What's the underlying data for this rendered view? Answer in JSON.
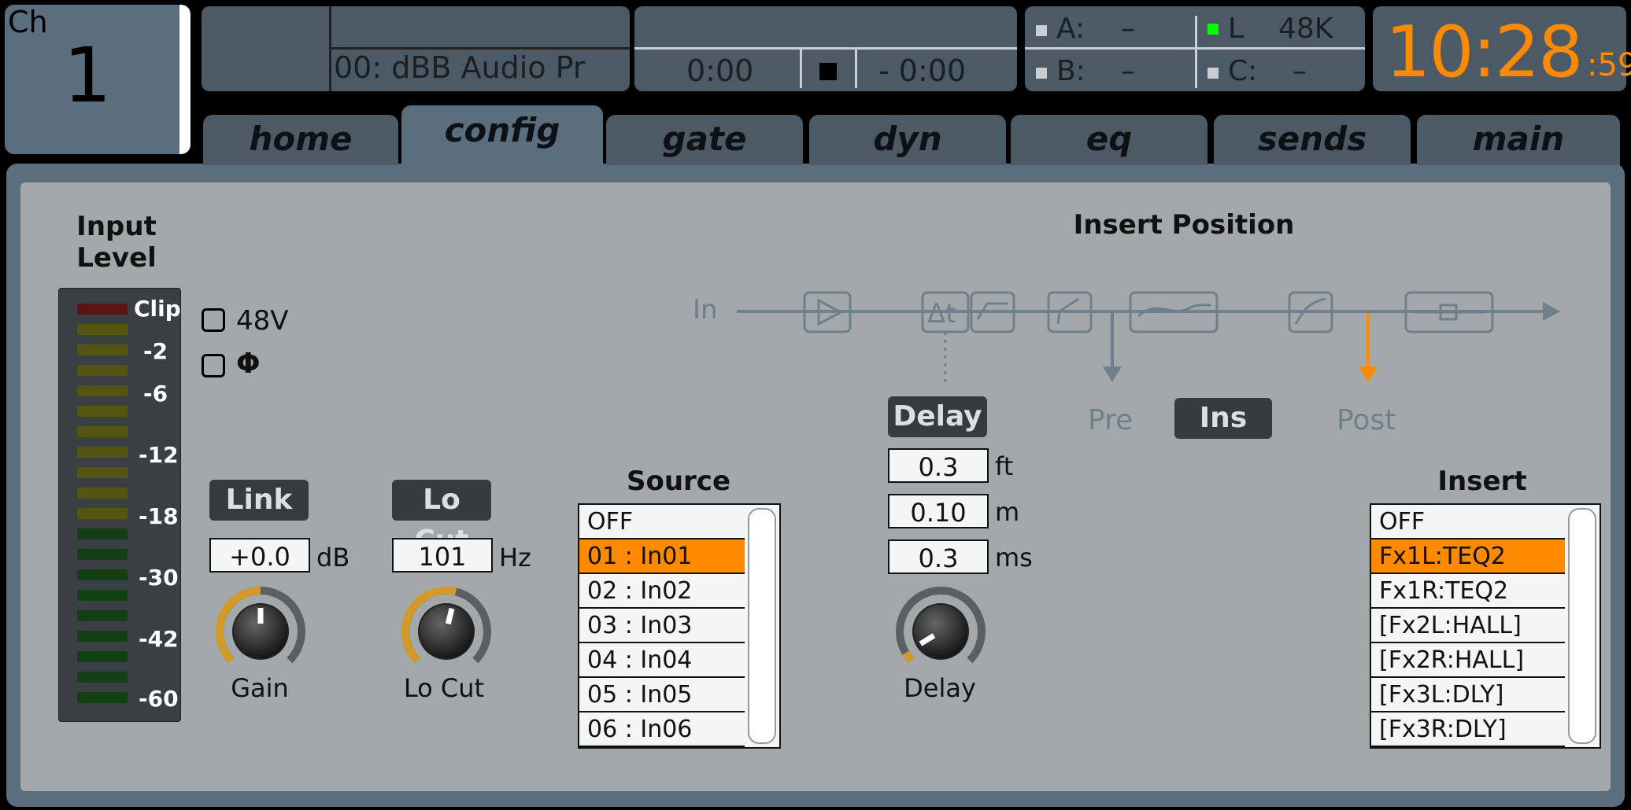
{
  "channel": {
    "label": "Ch",
    "number": "1"
  },
  "scene": {
    "text": "00: dBB Audio Pr"
  },
  "playback": {
    "time_elapsed": "0:00",
    "time_remaining": "- 0:00"
  },
  "io": {
    "a_label": "A:",
    "a_value": "–",
    "b_label": "B:",
    "b_value": "–",
    "l_label": "L",
    "l_value": "48K",
    "c_label": "C:",
    "c_value": "–",
    "l_indicator_color": "#00ff00"
  },
  "clock": {
    "main": "10:28",
    "seconds": ":59",
    "color": "#ff8a00"
  },
  "tabs": [
    {
      "label": "home"
    },
    {
      "label": "config"
    },
    {
      "label": "gate"
    },
    {
      "label": "dyn"
    },
    {
      "label": "eq"
    },
    {
      "label": "sends"
    },
    {
      "label": "main"
    }
  ],
  "active_tab": "config",
  "meter": {
    "title_line1": "Input",
    "title_line2": "Level",
    "labels": [
      "Clip",
      "-2",
      "-6",
      "-12",
      "-18",
      "-30",
      "-42",
      "-60"
    ]
  },
  "options": {
    "phantom_label": "48V",
    "phase_label": "Φ",
    "phantom_checked": false,
    "phase_checked": false
  },
  "gain": {
    "link_label": "Link",
    "value": "+0.0",
    "unit": "dB",
    "knob_label": "Gain",
    "knob_level": 0.5
  },
  "locut": {
    "button_label": "Lo Cut",
    "value": "101",
    "unit": "Hz",
    "knob_label": "Lo Cut",
    "knob_level": 0.55
  },
  "source": {
    "title": "Source",
    "items": [
      "OFF",
      "01 : In01",
      "02 : In02",
      "03 : In03",
      "04 : In04",
      "05 : In05",
      "06 : In06"
    ],
    "selected_index": 1
  },
  "insert_position": {
    "title": "Insert Position",
    "in_label": "In",
    "pre_label": "Pre",
    "ins_button": "Ins",
    "post_label": "Post"
  },
  "delay": {
    "button_label": "Delay",
    "ft_value": "0.3",
    "ft_unit": "ft",
    "m_value": "0.10",
    "m_unit": "m",
    "ms_value": "0.3",
    "ms_unit": "ms",
    "knob_label": "Delay",
    "knob_level": 0.05
  },
  "insert": {
    "title": "Insert",
    "items": [
      "OFF",
      "Fx1L:TEQ2",
      "Fx1R:TEQ2",
      "[Fx2L:HALL]",
      "[Fx2R:HALL]",
      "[Fx3L:DLY]",
      "[Fx3R:DLY]"
    ],
    "selected_index": 1
  }
}
